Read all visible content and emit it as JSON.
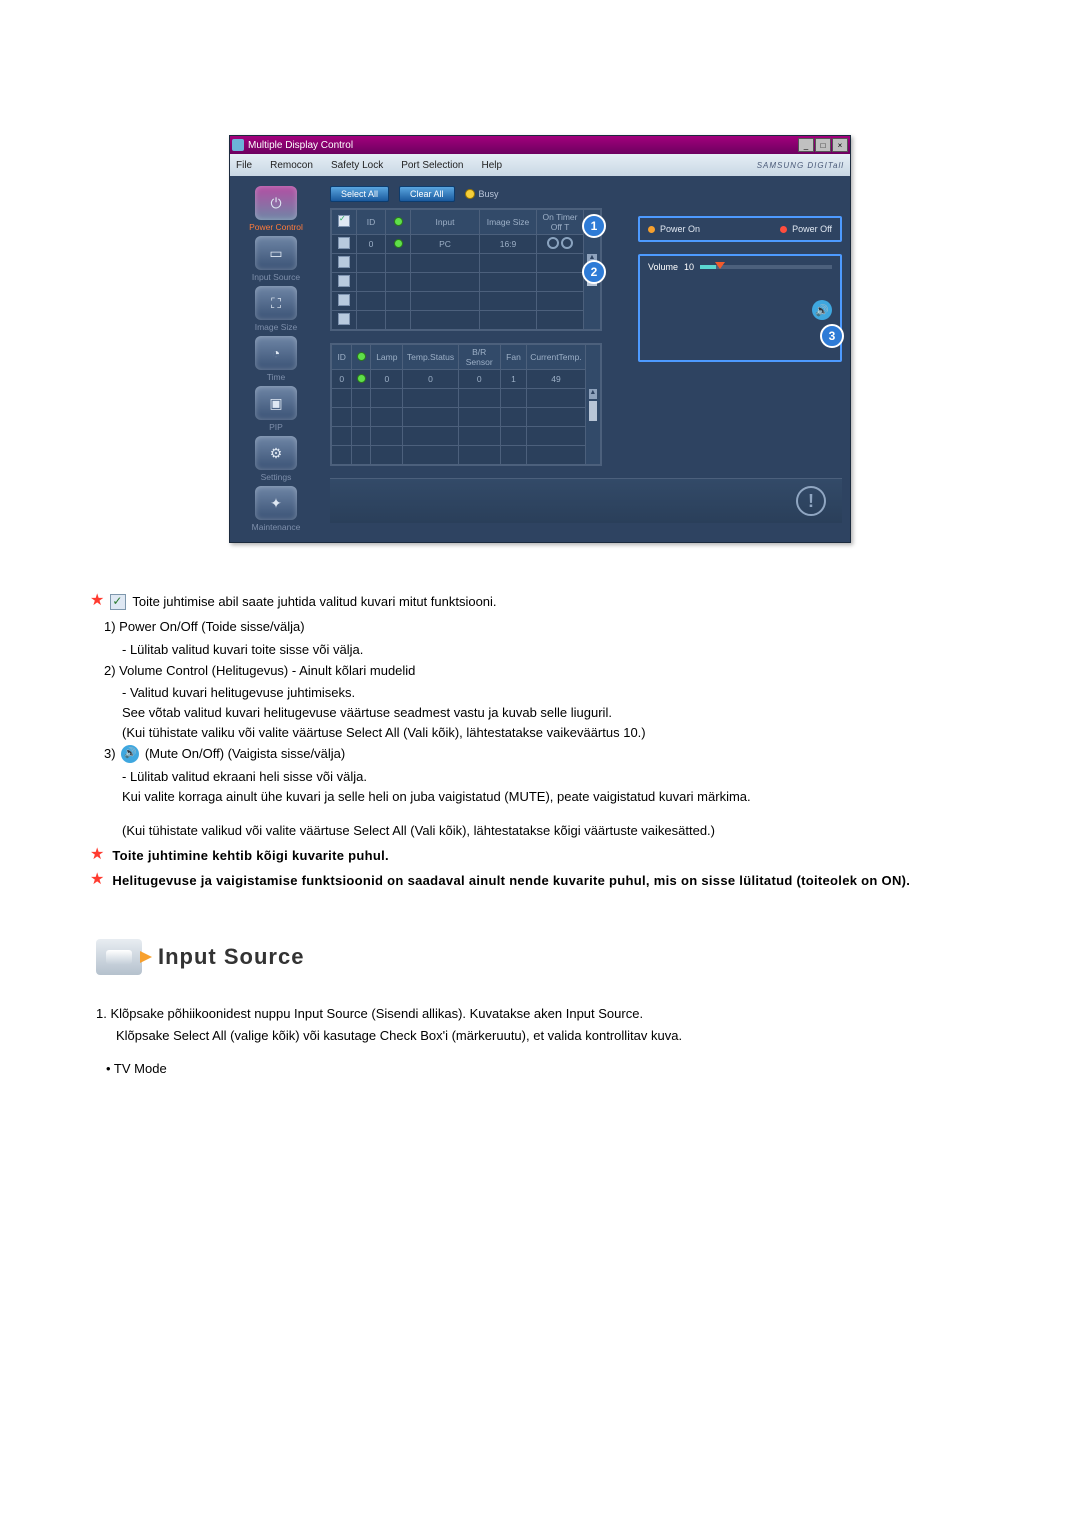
{
  "app": {
    "title": "Multiple Display Control",
    "menus": [
      "File",
      "Remocon",
      "Safety Lock",
      "Port Selection",
      "Help"
    ],
    "brand": "SAMSUNG DIGITall"
  },
  "sidebar": [
    {
      "label": "Power Control",
      "glyph": "⏻",
      "active": true
    },
    {
      "label": "Input Source",
      "glyph": "▭"
    },
    {
      "label": "Image Size",
      "glyph": "⛶"
    },
    {
      "label": "Time",
      "glyph": "◔"
    },
    {
      "label": "PIP",
      "glyph": "▣"
    },
    {
      "label": "Settings",
      "glyph": "⚙"
    },
    {
      "label": "Maintenance",
      "glyph": "✦"
    }
  ],
  "toolbar": {
    "select_all": "Select All",
    "clear_all": "Clear All",
    "busy": "Busy"
  },
  "table1": {
    "headers": [
      "",
      "ID",
      "",
      "Input",
      "Image Size",
      "On Timer Off T"
    ],
    "row": {
      "id": "0",
      "input": "PC",
      "image_size": "16:9"
    }
  },
  "table2": {
    "headers": [
      "ID",
      "",
      "Lamp",
      "Temp.Status",
      "B/R Sensor",
      "Fan",
      "CurrentTemp."
    ],
    "row": {
      "id": "0",
      "lamp": "0",
      "temp_status": "0",
      "br": "0",
      "fan": "1",
      "cur": "49"
    }
  },
  "right": {
    "power_on": "Power On",
    "power_off": "Power Off",
    "volume_label": "Volume",
    "volume_value": "10"
  },
  "callouts": {
    "c1": "1",
    "c2": "2",
    "c3": "3"
  },
  "doc": {
    "intro": "Toite juhtimise abil saate juhtida valitud kuvari mitut funktsiooni.",
    "n1": "1)  Power On/Off (Toide sisse/välja)",
    "n1a": "- Lülitab valitud kuvari toite sisse või välja.",
    "n2": "2)  Volume Control (Helitugevus) - Ainult kõlari mudelid",
    "n2a": "- Valitud kuvari helitugevuse juhtimiseks.",
    "n2b": "See võtab valitud kuvari helitugevuse väärtuse seadmest vastu ja kuvab selle liuguril.",
    "n2c": "(Kui tühistate valiku või valite väärtuse Select All (Vali kõik), lähtestatakse vaikeväärtus 10.)",
    "n3_pre": "3)",
    "n3_post": "(Mute On/Off) (Vaigista sisse/välja)",
    "n3a": "- Lülitab valitud ekraani heli sisse või välja.",
    "n3b": "Kui valite korraga ainult ühe kuvari ja selle heli on juba vaigistatud (MUTE), peate vaigistatud kuvari märkima.",
    "n3c": "(Kui tühistate valikud või valite väärtuse Select All (Vali kõik), lähtestatakse kõigi väärtuste vaikesätted.)",
    "note1": "Toite juhtimine kehtib kõigi kuvarite puhul.",
    "note2": "Helitugevuse ja vaigistamise funktsioonid on saadaval ainult nende kuvarite puhul, mis on sisse lülitatud (toiteolek on ON).",
    "section_title": "Input Source",
    "b1": "1.  Klõpsake põhiikoonidest nuppu Input Source (Sisendi allikas). Kuvatakse aken Input Source.",
    "b1a": "Klõpsake Select All (valige kõik) või kasutage Check Box'i (märkeruutu), et valida kontrollitav kuva.",
    "tv": "• TV Mode"
  }
}
